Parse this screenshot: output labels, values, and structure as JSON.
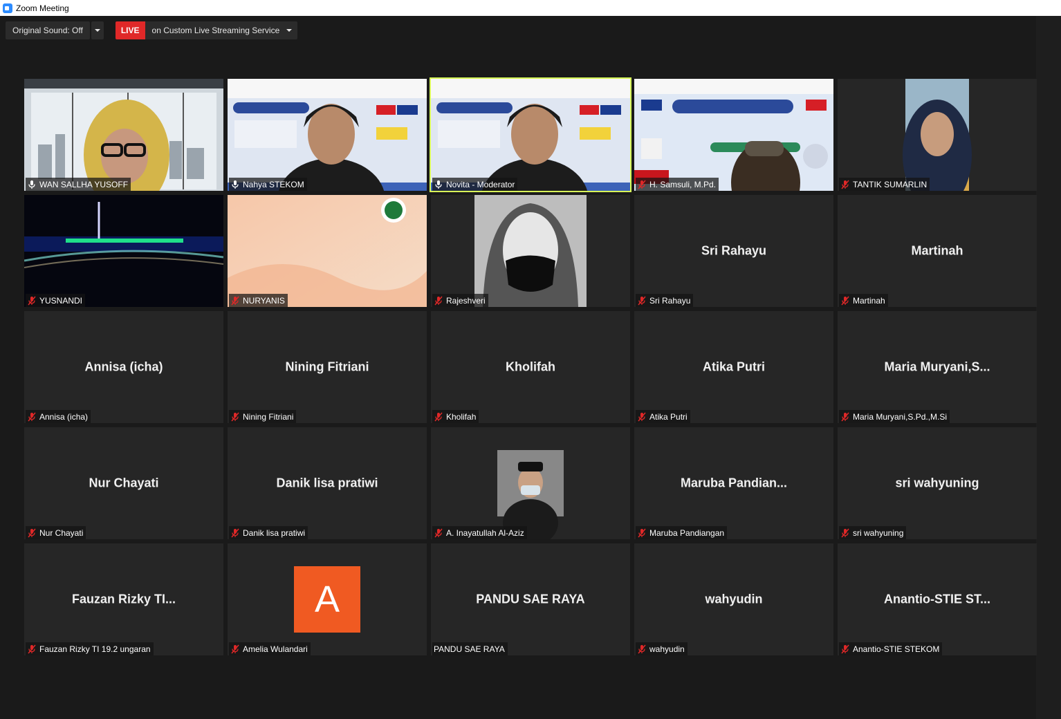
{
  "window": {
    "title": "Zoom Meeting"
  },
  "toolbar": {
    "original_sound_label": "Original Sound: Off",
    "live_badge": "LIVE",
    "live_service_label": "on Custom Live Streaming Service"
  },
  "colors": {
    "live_red": "#e02828",
    "active_speaker_border": "#d9ff57",
    "tile_bg": "#262626",
    "avatar_orange": "#f05a22"
  },
  "tiles": [
    {
      "label": "WAN SALLHA YUSOFF",
      "big_name": "",
      "mic": "unmuted",
      "kind": "video-webcam-window"
    },
    {
      "label": "Nahya STEKOM",
      "big_name": "",
      "mic": "unmuted",
      "kind": "video-webcam-banner"
    },
    {
      "label": "Novita - Moderator",
      "big_name": "",
      "mic": "unmuted",
      "kind": "video-webcam-banner",
      "active": true
    },
    {
      "label": "H. Samsuli, M.Pd.",
      "big_name": "",
      "mic": "muted",
      "kind": "video-banner-mirrored"
    },
    {
      "label": "TANTIK SUMARLIN",
      "big_name": "",
      "mic": "muted",
      "kind": "video-portrait"
    },
    {
      "label": "YUSNANDI",
      "big_name": "",
      "mic": "muted",
      "kind": "image-night"
    },
    {
      "label": "NURYANIS",
      "big_name": "",
      "mic": "muted",
      "kind": "image-peach"
    },
    {
      "label": "Rajeshveri",
      "big_name": "",
      "mic": "muted",
      "kind": "image-sketch"
    },
    {
      "label": "Sri Rahayu",
      "big_name": "Sri Rahayu",
      "mic": "muted",
      "kind": "name"
    },
    {
      "label": "Martinah",
      "big_name": "Martinah",
      "mic": "muted",
      "kind": "name"
    },
    {
      "label": "Annisa (icha)",
      "big_name": "Annisa (icha)",
      "mic": "muted",
      "kind": "name"
    },
    {
      "label": "Nining Fitriani",
      "big_name": "Nining Fitriani",
      "mic": "muted",
      "kind": "name"
    },
    {
      "label": "Kholifah",
      "big_name": "Kholifah",
      "mic": "muted",
      "kind": "name"
    },
    {
      "label": "Atika Putri",
      "big_name": "Atika Putri",
      "mic": "muted",
      "kind": "name"
    },
    {
      "label": "Maria Muryani,S.Pd.,M.Si",
      "big_name": "Maria  Muryani,S...",
      "mic": "muted",
      "kind": "name"
    },
    {
      "label": "Nur Chayati",
      "big_name": "Nur Chayati",
      "mic": "muted",
      "kind": "name"
    },
    {
      "label": "Danik lisa pratiwi",
      "big_name": "Danik lisa pratiwi",
      "mic": "muted",
      "kind": "name"
    },
    {
      "label": "A. Inayatullah Al-Aziz",
      "big_name": "",
      "mic": "muted",
      "kind": "profile-photo"
    },
    {
      "label": "Maruba Pandiangan",
      "big_name": "Maruba  Pandian...",
      "mic": "muted",
      "kind": "name"
    },
    {
      "label": "sri wahyuning",
      "big_name": "sri wahyuning",
      "mic": "muted",
      "kind": "name"
    },
    {
      "label": "Fauzan Rizky TI 19.2 ungaran",
      "big_name": "Fauzan  Rizky  TI...",
      "mic": "muted",
      "kind": "name"
    },
    {
      "label": "Amelia Wulandari",
      "big_name": "",
      "mic": "muted",
      "kind": "avatar",
      "avatar_letter": "A"
    },
    {
      "label": "PANDU SAE RAYA",
      "big_name": "PANDU SAE RAYA",
      "mic": "none",
      "kind": "name"
    },
    {
      "label": "wahyudin",
      "big_name": "wahyudin",
      "mic": "muted",
      "kind": "name"
    },
    {
      "label": "Anantio-STIE STEKOM",
      "big_name": "Anantio-STIE  ST...",
      "mic": "muted",
      "kind": "name"
    }
  ]
}
